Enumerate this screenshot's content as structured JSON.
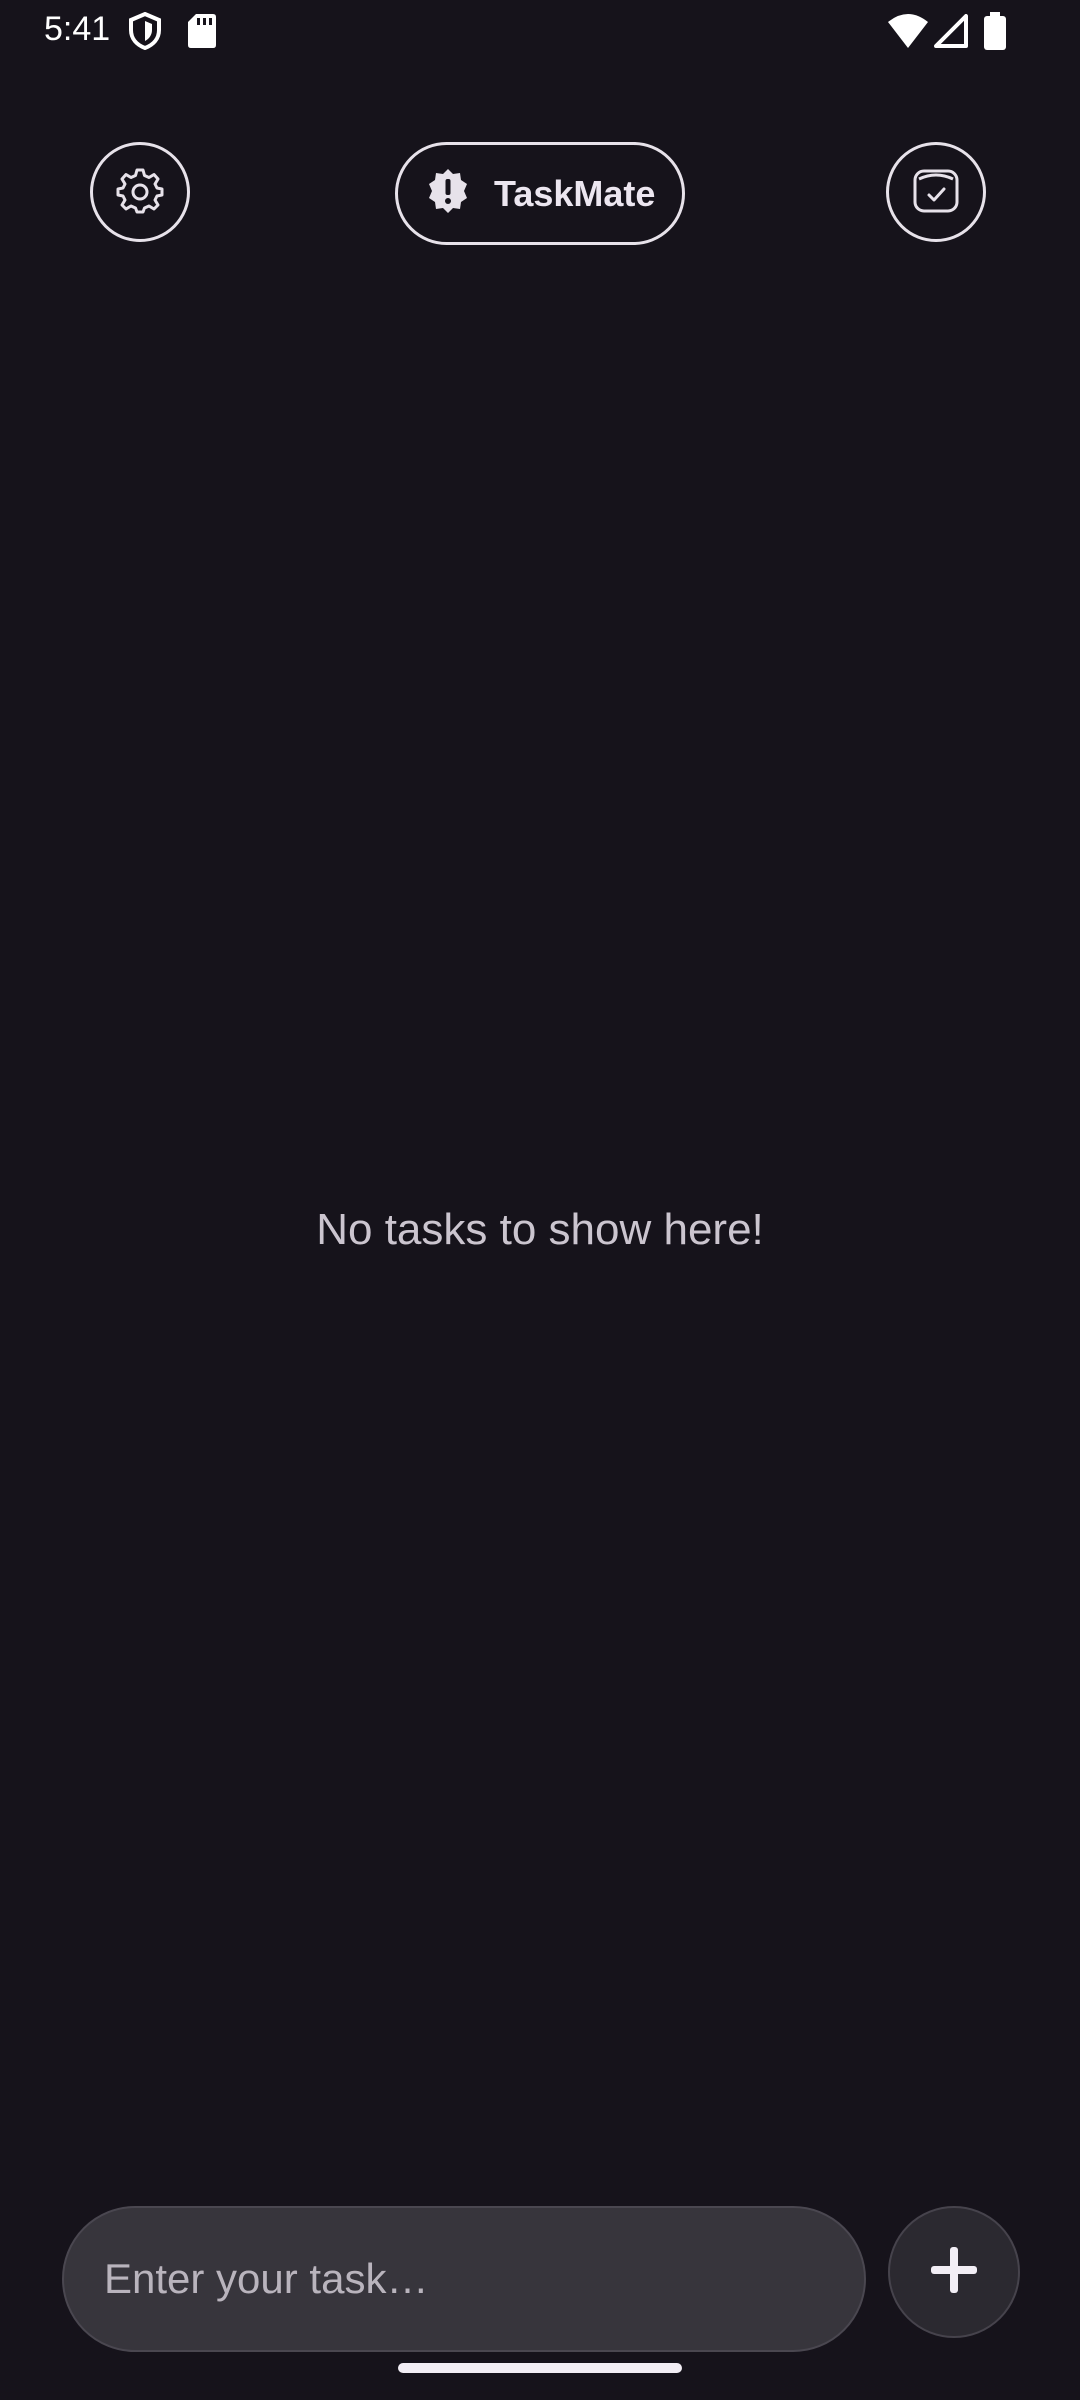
{
  "status_bar": {
    "time": "5:41",
    "icons": [
      "shield-icon",
      "sd-card-icon",
      "wifi-icon",
      "signal-icon",
      "battery-icon"
    ]
  },
  "header": {
    "app_title": "TaskMate",
    "settings_icon": "gear-icon",
    "title_icon": "alert-badge-icon",
    "calendar_icon": "calendar-check-icon"
  },
  "main": {
    "empty_message": "No tasks to show here!"
  },
  "composer": {
    "placeholder": "Enter your task…",
    "value": "",
    "add_icon": "plus-icon"
  },
  "colors": {
    "background": "#16131b",
    "foreground": "#e7e2ea",
    "input_bg": "#37353c",
    "button_bg": "#2b2930"
  }
}
